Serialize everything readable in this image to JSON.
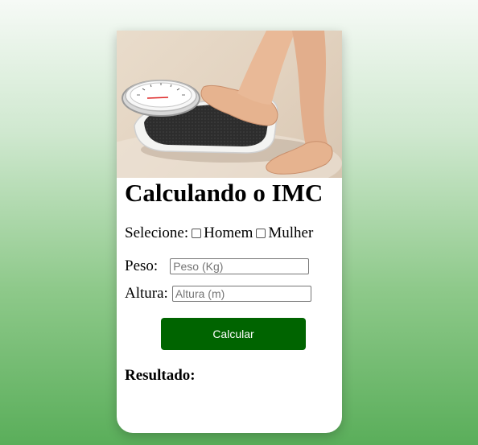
{
  "title": "Calculando o IMC",
  "sex": {
    "label": "Selecione:",
    "options": [
      "Homem",
      "Mulher"
    ]
  },
  "peso": {
    "label": "Peso:",
    "placeholder": "Peso (Kg)",
    "value": ""
  },
  "altura": {
    "label": "Altura:",
    "placeholder": "Altura (m)",
    "value": ""
  },
  "button": {
    "label": "Calcular",
    "color": "#006400"
  },
  "result": {
    "label": "Resultado:"
  },
  "image": {
    "icon": "bathroom-scale-feet-photo"
  },
  "colors": {
    "accent": "#006400",
    "background_top": "#f6faf6",
    "background_bottom": "#5aae5a"
  }
}
